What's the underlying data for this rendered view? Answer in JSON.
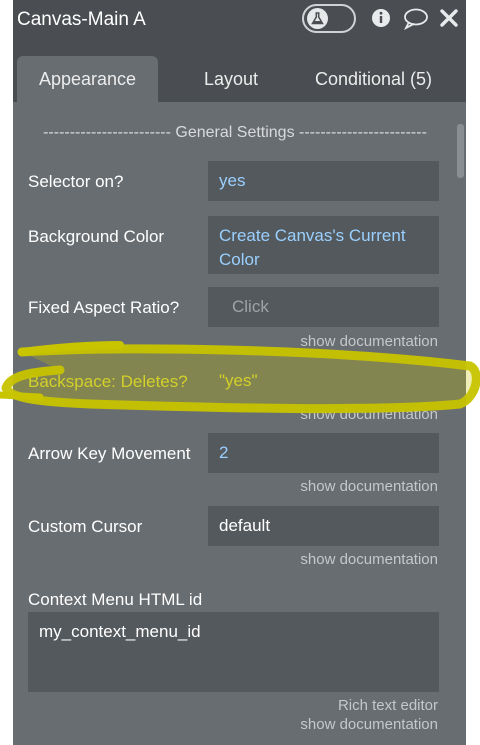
{
  "header": {
    "title": "Canvas-Main A",
    "icons": [
      "flask-icon",
      "info-icon",
      "comment-icon",
      "close-icon"
    ]
  },
  "tabs": [
    {
      "label": "Appearance",
      "active": true
    },
    {
      "label": "Layout",
      "active": false
    },
    {
      "label": "Conditional (5)",
      "active": false
    }
  ],
  "section_title": "------------------------ General Settings ------------------------",
  "rows": [
    {
      "label": "Selector on?",
      "value": "yes"
    },
    {
      "label": "Background Color",
      "value": "Create Canvas's Current Color"
    },
    {
      "label": "Fixed Aspect Ratio?",
      "placeholder": "Click",
      "doc": "show documentation"
    },
    {
      "label": "Backspace: Deletes?",
      "value": "\"yes\"",
      "doc": "show documentation",
      "highlighted": true
    },
    {
      "label": "Arrow Key Movement",
      "value": "2",
      "doc": "show documentation"
    },
    {
      "label": "Custom Cursor",
      "value": "default",
      "doc": "show documentation"
    }
  ],
  "context_menu": {
    "label": "Context Menu HTML id",
    "value": "my_context_menu_id",
    "rich_text_editor": "Rich text editor",
    "doc": "show documentation"
  },
  "colors": {
    "panel": "#686d71",
    "header": "#4a4e52",
    "field": "#54595d",
    "value_blue": "#9ad0ff",
    "highlight": "#c8c400"
  }
}
